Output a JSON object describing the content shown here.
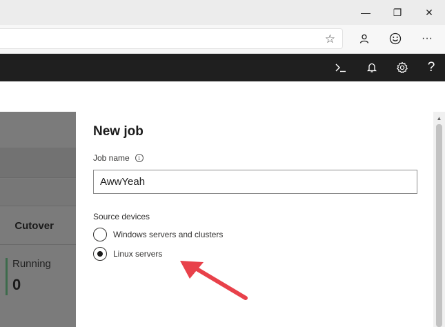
{
  "window_controls": {
    "minimize": "—",
    "maximize": "❐",
    "close": "✕"
  },
  "browser": {
    "favorite_icon": "☆",
    "more_icon": "···"
  },
  "header": {
    "help_label": "?"
  },
  "background": {
    "column_header": "Cutover",
    "status_label": "Running",
    "status_count": "0",
    "status_color": "#3d6b4c"
  },
  "panel": {
    "title": "New job",
    "job_name_label": "Job name",
    "info_icon_glyph": "i",
    "job_name_value": "AwwYeah",
    "source_devices_label": "Source devices",
    "options": [
      {
        "label": "Windows servers and clusters",
        "selected": false
      },
      {
        "label": "Linux servers",
        "selected": true
      }
    ]
  },
  "annotation": {
    "arrow_color": "#e8414a"
  },
  "icons": [
    "minimize-icon",
    "maximize-icon",
    "close-icon",
    "star-icon",
    "profile-icon",
    "emoji-icon",
    "more-icon",
    "console-icon",
    "bell-icon",
    "gear-icon",
    "help-icon",
    "info-icon"
  ]
}
